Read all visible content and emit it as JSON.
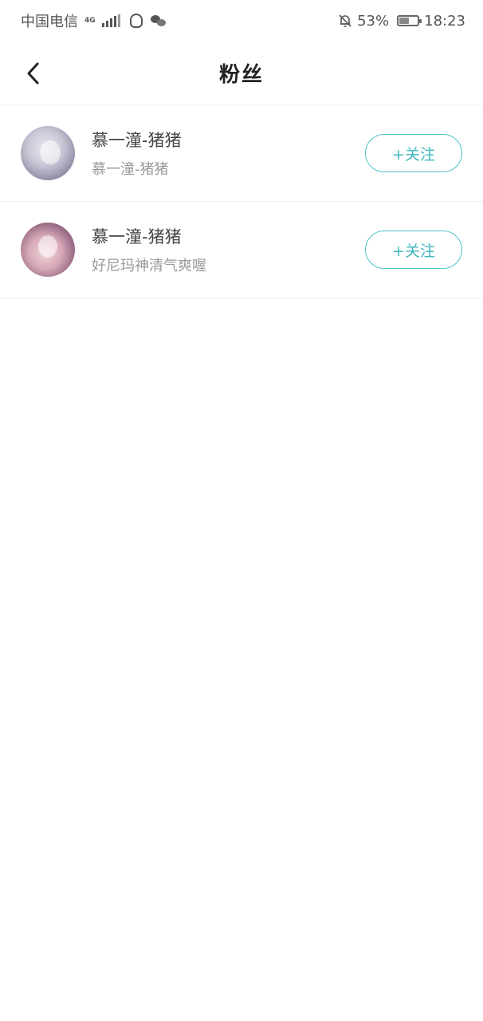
{
  "status_bar": {
    "carrier": "中国电信",
    "network_badge": "4G",
    "battery_percent_text": "53%",
    "battery_level": 0.53,
    "time": "18:23",
    "icons": [
      "signal-icon",
      "qq-icon",
      "wechat-icon",
      "bell-off-icon",
      "battery-icon"
    ]
  },
  "header": {
    "title": "粉丝",
    "back_icon": "chevron-left-icon"
  },
  "fans": [
    {
      "name": "慕一潼-猪猪",
      "desc": "慕一潼-猪猪",
      "follow_label": "+关注"
    },
    {
      "name": "慕一潼-猪猪",
      "desc": "好尼玛神清气爽喔",
      "follow_label": "+关注"
    }
  ],
  "colors": {
    "accent": "#3fb8bf",
    "divider": "#eeeeee",
    "name_text": "#444444",
    "desc_text": "#9a9a9a"
  }
}
